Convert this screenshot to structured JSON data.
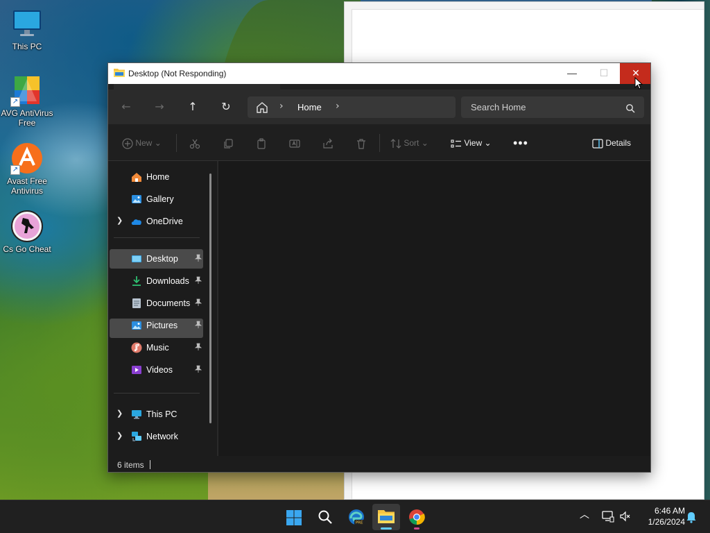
{
  "desktop": {
    "icons": [
      {
        "label": "This PC"
      },
      {
        "label": "AVG AntiVirus Free"
      },
      {
        "label": "Avast Free Antivirus"
      },
      {
        "label": "Cs Go Cheat"
      }
    ]
  },
  "window": {
    "title": "Desktop (Not Responding)",
    "minimize_glyph": "—",
    "maximize_glyph": "☐",
    "close_glyph": "✕"
  },
  "navbar": {
    "breadcrumb": "Home",
    "search_placeholder": "Search Home"
  },
  "toolbar": {
    "new_label": "New",
    "sort_label": "Sort",
    "view_label": "View",
    "details_label": "Details"
  },
  "sidebar": {
    "items": [
      {
        "label": "Home"
      },
      {
        "label": "Gallery"
      },
      {
        "label": "OneDrive"
      },
      {
        "label": "Desktop"
      },
      {
        "label": "Downloads"
      },
      {
        "label": "Documents"
      },
      {
        "label": "Pictures"
      },
      {
        "label": "Music"
      },
      {
        "label": "Videos"
      },
      {
        "label": "This PC"
      },
      {
        "label": "Network"
      }
    ]
  },
  "status": {
    "item_count": "6 items"
  },
  "taskbar": {
    "time": "6:46 AM",
    "date": "1/26/2024"
  },
  "colors": {
    "close_button": "#c42b1c",
    "selection": "#4a4a4a",
    "accent": "#60cdff"
  }
}
